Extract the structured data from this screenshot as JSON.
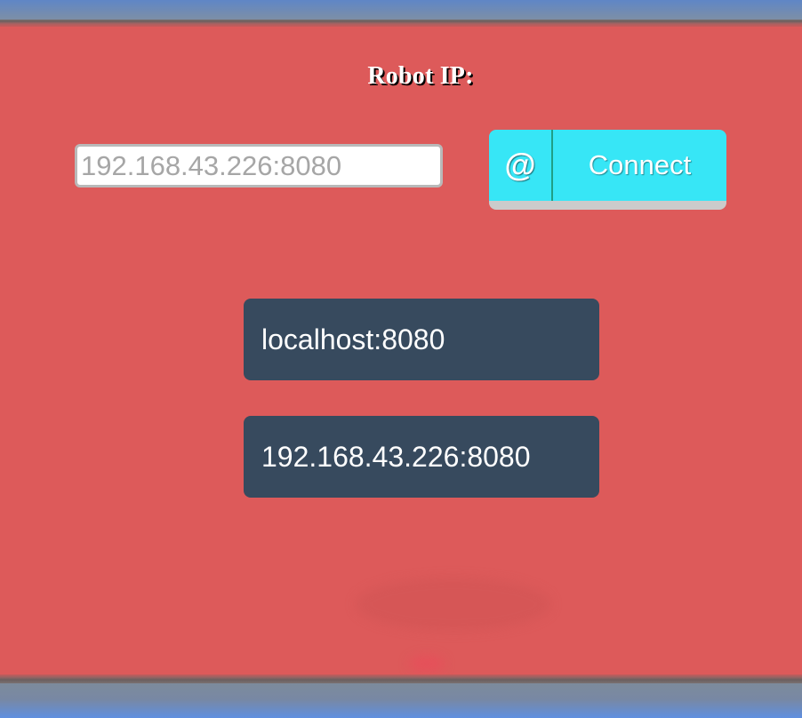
{
  "header": {
    "title": "Robot IP:"
  },
  "connect_form": {
    "input_placeholder": "192.168.43.226:8080",
    "input_value": "",
    "button_icon": "@",
    "button_label": "Connect"
  },
  "saved_hosts": [
    {
      "label": "localhost:8080"
    },
    {
      "label": "192.168.43.226:8080"
    }
  ],
  "colors": {
    "background": "#dd5a5a",
    "button": "#37e6f6",
    "host_item": "#374a5e"
  }
}
